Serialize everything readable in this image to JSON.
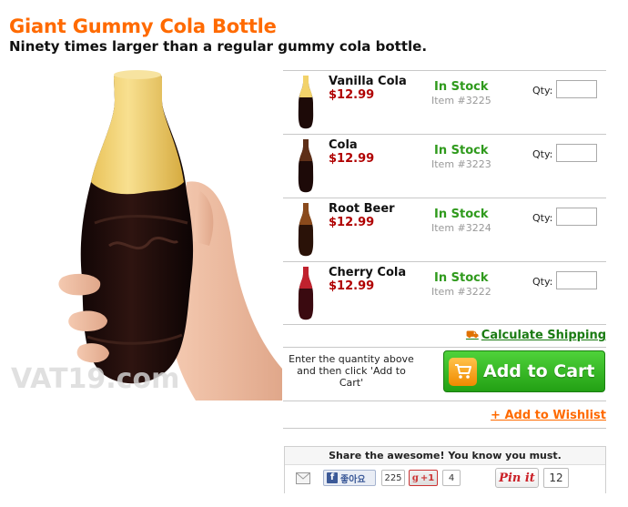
{
  "product": {
    "title": "Giant Gummy Cola Bottle",
    "subtitle": "Ninety times larger than a regular gummy cola bottle."
  },
  "hero_image": {
    "watermark": "VAT19.com"
  },
  "options": [
    {
      "name": "Vanilla Cola",
      "price": "$12.99",
      "stock": "In Stock",
      "item": "Item #3225",
      "qty_label": "Qty:",
      "qty_value": "",
      "top_color": "#f2d26a"
    },
    {
      "name": "Cola",
      "price": "$12.99",
      "stock": "In Stock",
      "item": "Item #3223",
      "qty_label": "Qty:",
      "qty_value": "",
      "top_color": "#6b3a1e"
    },
    {
      "name": "Root Beer",
      "price": "$12.99",
      "stock": "In Stock",
      "item": "Item #3224",
      "qty_label": "Qty:",
      "qty_value": "",
      "top_color": "#8a4a1c"
    },
    {
      "name": "Cherry Cola",
      "price": "$12.99",
      "stock": "In Stock",
      "item": "Item #3222",
      "qty_label": "Qty:",
      "qty_value": "",
      "top_color": "#c0222e"
    }
  ],
  "shipping": {
    "label": "Calculate Shipping"
  },
  "cart": {
    "instructions": "Enter the quantity above and then click 'Add to Cart'",
    "button_label": "Add to Cart"
  },
  "wishlist": {
    "label": "+ Add to Wishlist"
  },
  "share": {
    "title": "Share the awesome! You know you must.",
    "facebook_label": "좋아요",
    "facebook_count": "225",
    "gplus_label": "+1",
    "gplus_count": "4",
    "pinterest_label": "Pin it",
    "pinterest_count": "12"
  },
  "colors": {
    "title": "#ff6a00",
    "stock": "#2f9a1c",
    "price": "#b00000",
    "cart_button": "#2fae1e",
    "shipping_link": "#1a7b12"
  },
  "icons": [
    "truck-icon",
    "cart-icon",
    "mail-icon",
    "facebook-icon",
    "gplus-icon",
    "pinterest-icon"
  ]
}
